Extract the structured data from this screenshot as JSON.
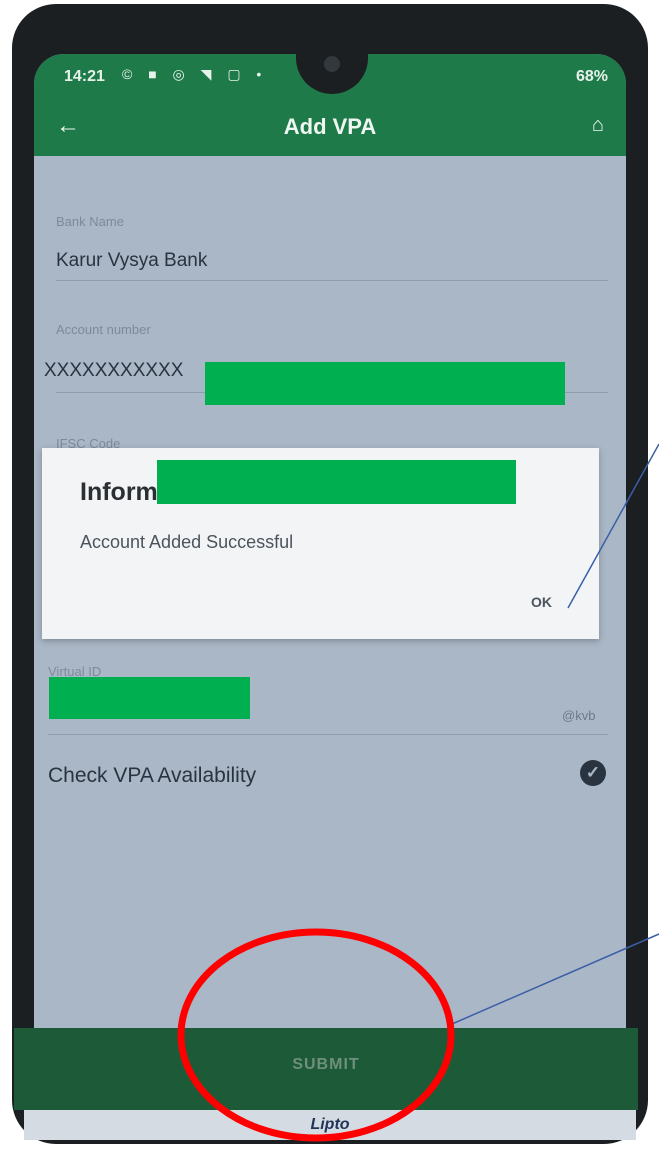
{
  "status_bar": {
    "time": "14:21",
    "icons": "© ■ ◎ ◥ ▢ •",
    "battery": "68%"
  },
  "app_bar": {
    "title": "Add VPA"
  },
  "form": {
    "bank_name_label": "Bank Name",
    "bank_name_value": "Karur Vysya Bank",
    "account_number_label": "Account number",
    "account_number_value": "XXXXXXXXXXX",
    "ifsc_label": "IFSC Code",
    "virtual_id_label": "Virtual ID",
    "virtual_id_suffix": "@kvb",
    "check_vpa_label": "Check VPA Availability"
  },
  "dialog": {
    "title": "Inform",
    "message": "Account Added Successful",
    "ok_label": "OK"
  },
  "submit": {
    "label": "SUBMIT"
  },
  "bottom": {
    "logo_text": "Lipto"
  },
  "colors": {
    "app_green": "#1f7a4a",
    "submit_green": "#1c5a38",
    "redaction_green": "#00b050",
    "annotation_red": "#ff0000",
    "annotation_line": "#3a5fa8"
  }
}
